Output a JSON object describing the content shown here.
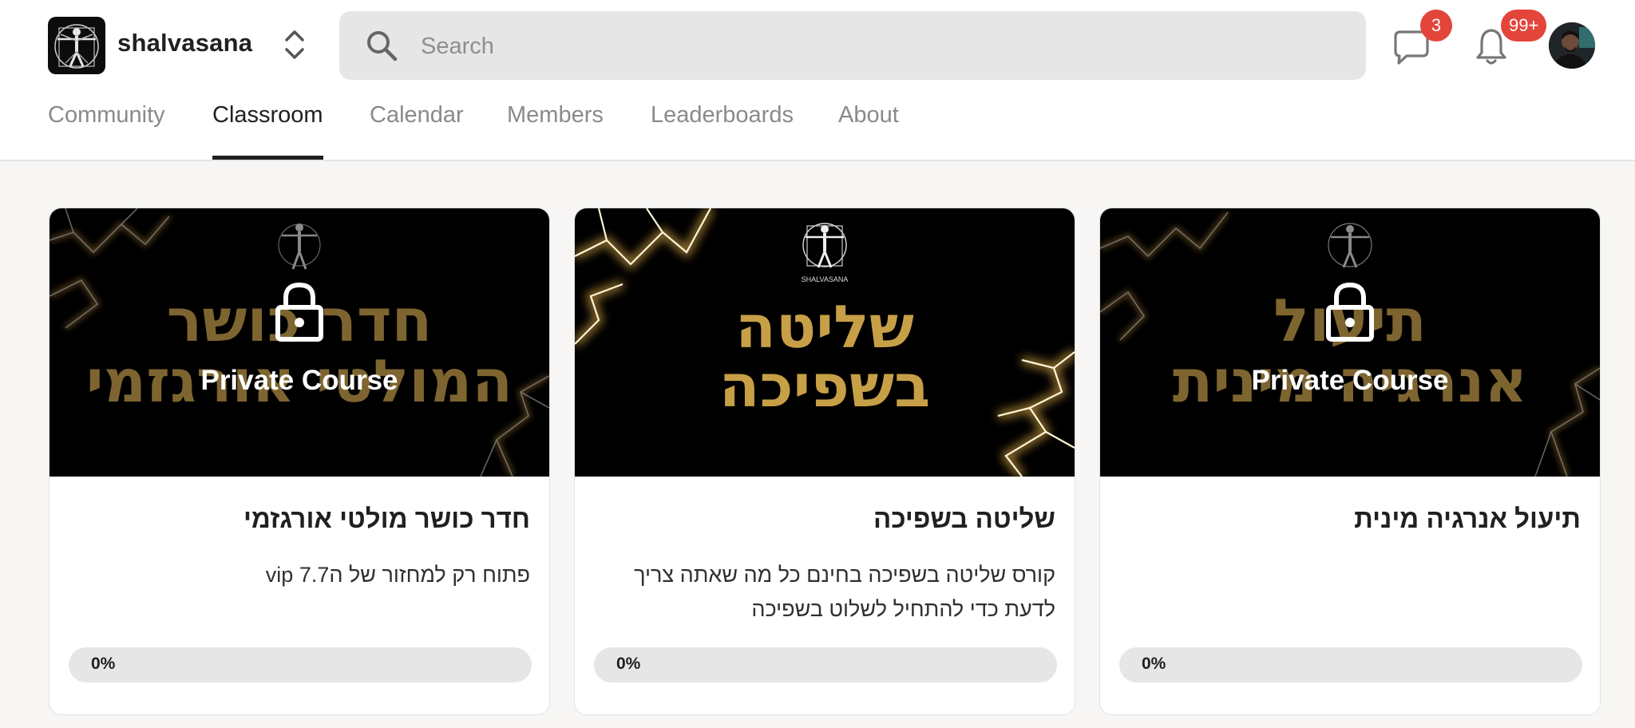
{
  "header": {
    "group_name": "shalvasana",
    "search": {
      "placeholder": "Search"
    },
    "chat_badge": "3",
    "notifications_badge": "99+",
    "icons": {
      "search": "search-icon",
      "chat": "chat-bubble-icon",
      "notifications": "bell-icon",
      "switcher": "chevron-up-down-icon"
    }
  },
  "tabs": [
    {
      "label": "Community",
      "active": false
    },
    {
      "label": "Classroom",
      "active": true
    },
    {
      "label": "Calendar",
      "active": false
    },
    {
      "label": "Members",
      "active": false
    },
    {
      "label": "Leaderboards",
      "active": false
    },
    {
      "label": "About",
      "active": false
    }
  ],
  "courses": [
    {
      "banner_line1": "חדר כושר",
      "banner_line2": "המולטי אורגזמי",
      "private_label": "Private Course",
      "title": "חדר כושר מולטי אורגזמי",
      "description": "פתוח רק למחזור של ה7.7 vip",
      "progress": 0,
      "progress_label": "0%",
      "locked": true
    },
    {
      "banner_logo_text": "SHALVASANA",
      "banner_line1": "שליטה",
      "banner_line2": "בשפיכה",
      "title": "שליטה בשפיכה",
      "description": "קורס שליטה בשפיכה בחינם כל מה שאתה צריך לדעת כדי להתחיל לשלוט בשפיכה",
      "progress": 0,
      "progress_label": "0%",
      "locked": false
    },
    {
      "banner_line1": "תיעול",
      "banner_line2": "אנרגיה מינית",
      "private_label": "Private Course",
      "title": "תיעול אנרגיה מינית",
      "description": "",
      "progress": 0,
      "progress_label": "0%",
      "locked": true
    }
  ],
  "colors": {
    "accent_gold": "#c79f46",
    "badge_red": "#e3453a",
    "page_bg": "#f7f6f4"
  }
}
